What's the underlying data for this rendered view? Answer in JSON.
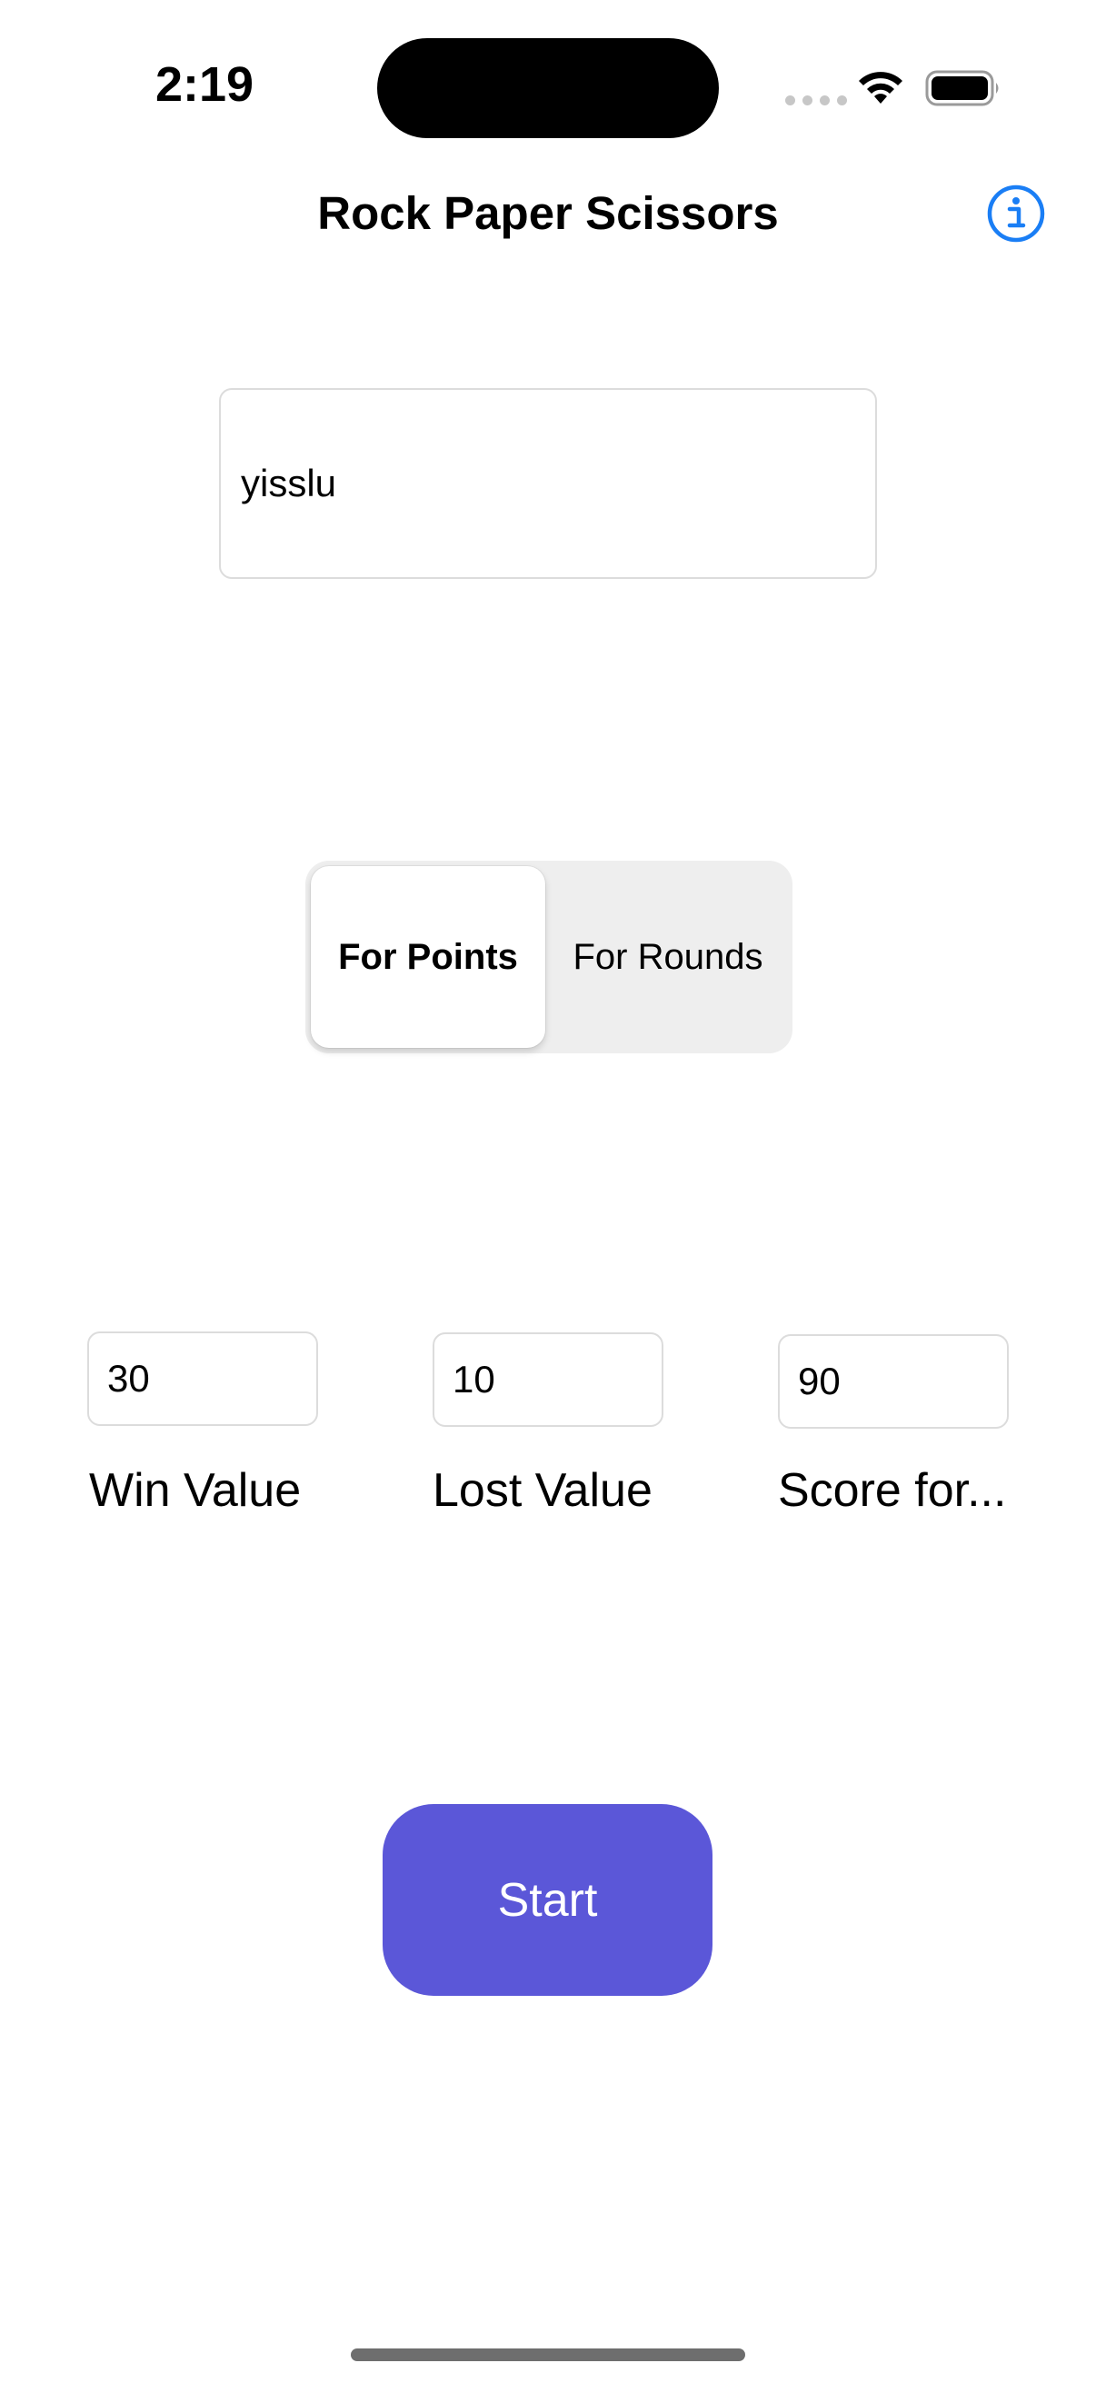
{
  "status_bar": {
    "time": "2:19"
  },
  "nav": {
    "title": "Rock Paper Scissors",
    "info_icon": "info-circle-icon"
  },
  "name_field": {
    "value": "yisslu"
  },
  "mode_selector": {
    "options": [
      "For Points",
      "For Rounds"
    ],
    "selected": "For Points"
  },
  "values": [
    {
      "label": "Win Value",
      "value": "30"
    },
    {
      "label": "Lost Value",
      "value": "10"
    },
    {
      "label": "Score for...",
      "value": "90"
    }
  ],
  "start_button": {
    "label": "Start"
  },
  "colors": {
    "accent": "#5b57d8",
    "info_blue": "#1a7ef5",
    "segment_bg": "#eeeeee",
    "field_border": "#dcdcdc"
  }
}
